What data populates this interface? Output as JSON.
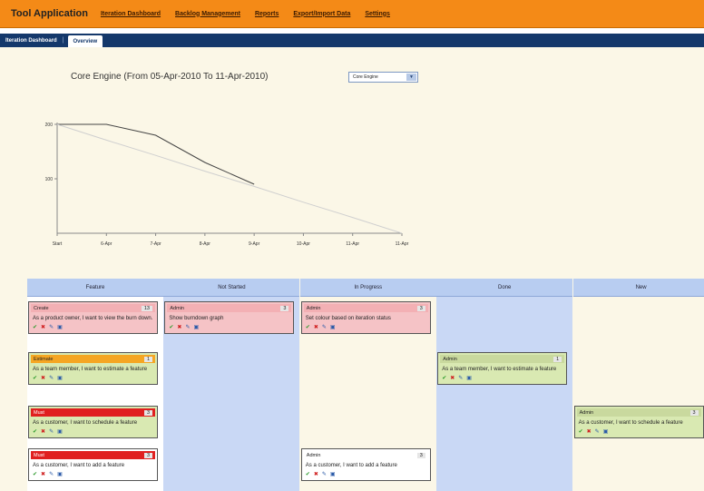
{
  "app": {
    "title": "Tool Application",
    "menu": [
      "Iteration Dashboard",
      "Backlog Management",
      "Reports",
      "Export/Import Data",
      "Settings"
    ]
  },
  "subnav": {
    "items": [
      "Iteration Dashboard",
      "Overview"
    ],
    "active": "Overview"
  },
  "chart_header": {
    "title": "Core Engine (From 05-Apr-2010 To 11-Apr-2010)",
    "engine_select_value": "Core Engine"
  },
  "chart_data": {
    "type": "line",
    "x": [
      "Start",
      "6-Apr",
      "7-Apr",
      "8-Apr",
      "9-Apr",
      "10-Apr",
      "11-Apr",
      "11-Apr"
    ],
    "series": [
      {
        "values": [
          200,
          200,
          180,
          130,
          90,
          null,
          null,
          null
        ]
      },
      {
        "values": [
          200,
          171,
          143,
          114,
          86,
          57,
          29,
          0
        ]
      }
    ],
    "yticks": [
      "200",
      "100"
    ],
    "ylim": [
      0,
      200
    ],
    "grid": false
  },
  "board": {
    "columns": [
      "Feature",
      "Not Started",
      "In Progress",
      "Done",
      "New"
    ],
    "cards": [
      {
        "col": 0,
        "row": 0,
        "tag": "Create",
        "count": "13",
        "text": "As a product owner, I want to view the burn down.",
        "style": "pink",
        "tagColor": "#f3b0b4"
      },
      {
        "col": 1,
        "row": 0,
        "tag": "Admin",
        "count": "3",
        "text": "Show burndown graph",
        "style": "pink",
        "tagColor": "#f3b0b4"
      },
      {
        "col": 2,
        "row": 0,
        "tag": "Admin",
        "count": "3",
        "text": "Set colour based on iteration status",
        "style": "pink",
        "tagColor": "#f3b0b4"
      },
      {
        "col": 0,
        "row": 1,
        "tag": "Estimate",
        "count": "1",
        "text": "As a team member, I want to estimate a feature",
        "style": "green",
        "tagColor": "#f5a623"
      },
      {
        "col": 3,
        "row": 1,
        "tag": "Admin",
        "count": "1",
        "text": "As a team member, I want to estimate a feature",
        "style": "green",
        "tagColor": "#c9d99e"
      },
      {
        "col": 0,
        "row": 2,
        "tag": "Must",
        "count": "3",
        "text": "As a customer, I want to schedule a feature",
        "style": "green",
        "tagColor": "#e02020"
      },
      {
        "col": 4,
        "row": 2,
        "tag": "Admin",
        "count": "3",
        "text": "As a customer, I want to schedule a feature",
        "style": "green",
        "tagColor": "#c9d99e"
      },
      {
        "col": 0,
        "row": 3,
        "tag": "Must",
        "count": "3",
        "text": "As a customer, I want to add a feature",
        "style": "white",
        "tagColor": "#e02020"
      },
      {
        "col": 2,
        "row": 3,
        "tag": "Admin",
        "count": "3",
        "text": "As a customer, I want to add a feature",
        "style": "white",
        "tagColor": "#ffffff"
      }
    ]
  },
  "colors": {
    "topbar": "#f48a17",
    "subnav": "#14386b",
    "background": "#fbf7e7",
    "column_header": "#b8cdf1",
    "column_fill": "#c9d8f5"
  }
}
